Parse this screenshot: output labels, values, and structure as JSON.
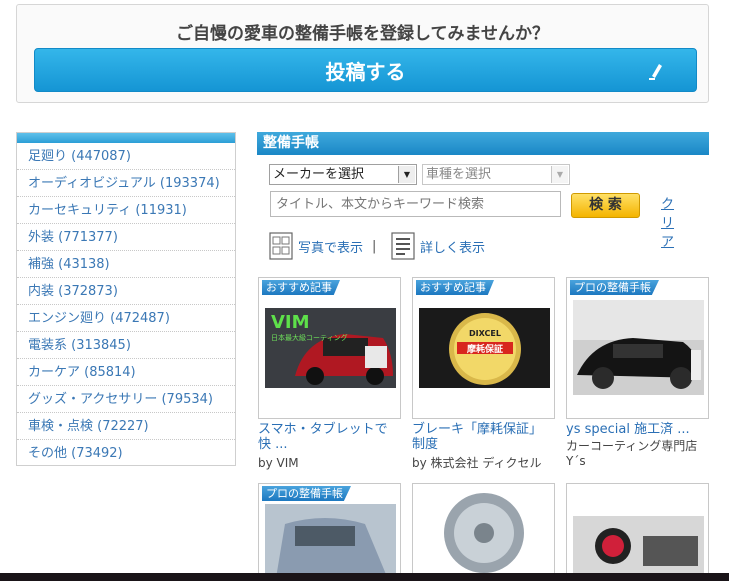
{
  "post_panel": {
    "question": "ご自慢の愛車の整備手帳を登録してみませんか？",
    "button_label": "投稿する"
  },
  "sidebar": {
    "items": [
      {
        "label": "足廻り (447087)"
      },
      {
        "label": "オーディオビジュアル (193374)"
      },
      {
        "label": "カーセキュリティ (11931)"
      },
      {
        "label": "外装 (771377)"
      },
      {
        "label": "補強 (43138)"
      },
      {
        "label": "内装 (372873)"
      },
      {
        "label": "エンジン廻り (472487)"
      },
      {
        "label": "電装系 (313845)"
      },
      {
        "label": "カーケア (85814)"
      },
      {
        "label": "グッズ・アクセサリー (79534)"
      },
      {
        "label": "車検・点検 (72227)"
      },
      {
        "label": "その他 (73492)"
      }
    ]
  },
  "main": {
    "title": "整備手帳",
    "filters": {
      "maker_select": "メーカーを選択",
      "model_select": "車種を選択",
      "keyword_placeholder": "タイトル、本文からキーワード検索",
      "search_label": "検 索",
      "clear_label": "クリア"
    },
    "view": {
      "photo_label": "写真で表示",
      "separator": "|",
      "detail_label": "詳しく表示"
    },
    "cards": [
      {
        "badge": "おすすめ記事",
        "title_line1": "スマホ・タブレットで",
        "title_line2": "快 ...",
        "author": "by VIM",
        "thumb_text": "VIM",
        "thumb_sub": "日本最大級コーティング"
      },
      {
        "badge": "おすすめ記事",
        "title_line1": "ブレーキ「摩耗保証」",
        "title_line2": "制度",
        "author": "by 株式会社 ディクセル",
        "thumb_text": "DIXCEL",
        "thumb_sub": "摩耗保証"
      },
      {
        "badge": "プロの整備手帳",
        "title_line1": "ys special 施工済 ...",
        "title_line2": "",
        "author": "カーコーティング専門店",
        "author2": "Y´s"
      },
      {
        "badge": "プロの整備手帳"
      },
      {},
      {}
    ]
  },
  "colors": {
    "accent_blue": "#1a87c6",
    "link_blue": "#2a6fb5",
    "search_yellow": "#f4b400"
  }
}
